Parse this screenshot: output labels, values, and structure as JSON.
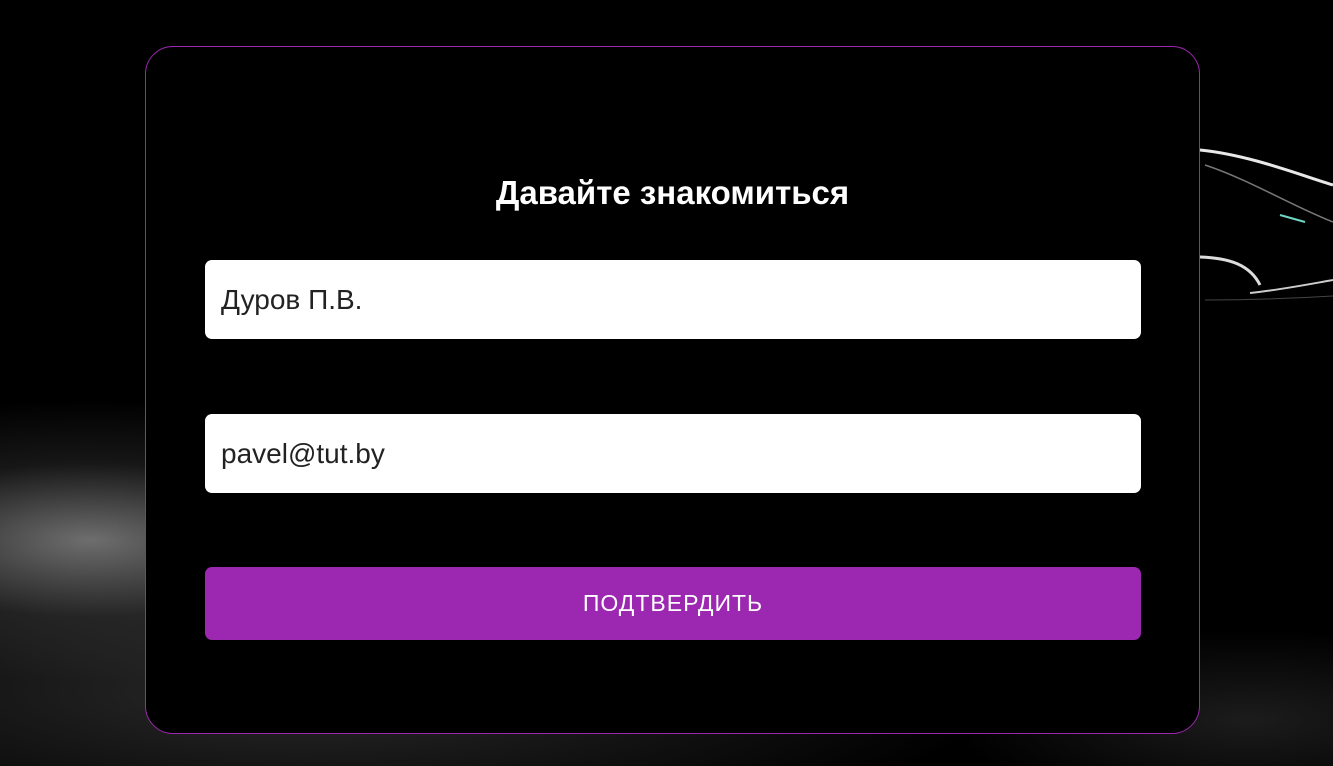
{
  "form": {
    "title": "Давайте знакомиться",
    "name_value": "Дуров П.В.",
    "email_value": "pavel@tut.by",
    "submit_label": "ПОДТВЕРДИТЬ"
  },
  "colors": {
    "accent": "#9c27b0",
    "background": "#000000",
    "field_background": "#ffffff",
    "text_light": "#ffffff",
    "text_dark": "#222222"
  }
}
